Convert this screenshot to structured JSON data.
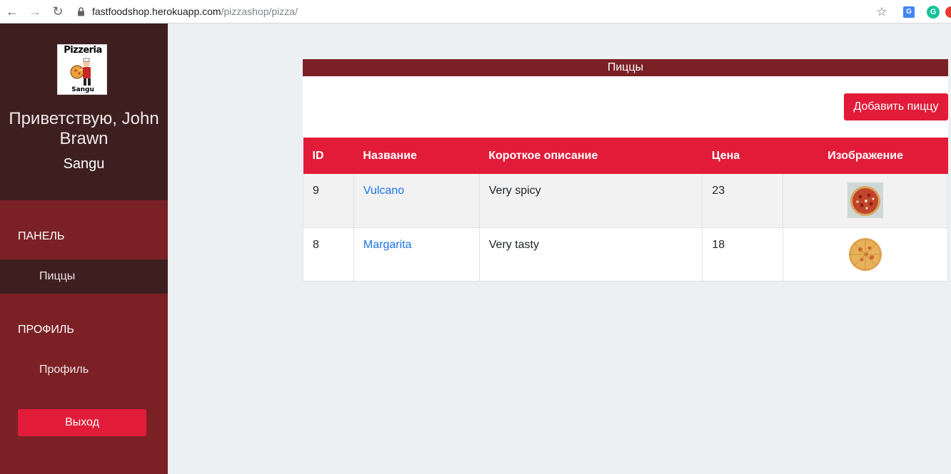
{
  "browser": {
    "url_host": "fastfoodshop.herokuapp.com",
    "url_path": "/pizzashop/pizza/"
  },
  "sidebar": {
    "logo_top": "Pizzeria",
    "logo_bottom": "Sangu",
    "welcome": "Приветствую, John Brawn",
    "shop": "Sangu",
    "section_panel": "ПАНЕЛЬ",
    "item_pizzas": "Пиццы",
    "section_profile": "ПРОФИЛЬ",
    "item_profile": "Профиль",
    "logout": "Выход"
  },
  "panel": {
    "title": "Пиццы",
    "add_button": "Добавить пиццу"
  },
  "table": {
    "headers": [
      "ID",
      "Название",
      "Короткое описание",
      "Цена",
      "Изображение"
    ],
    "rows": [
      {
        "id": "9",
        "name": "Vulcano",
        "description": "Very spicy",
        "price": "23",
        "image": "pizza-vulcano-image"
      },
      {
        "id": "8",
        "name": "Margarita",
        "description": "Very tasty",
        "price": "18",
        "image": "pizza-margarita-image"
      }
    ]
  },
  "colors": {
    "sidebar_dark": "#3e1f1f",
    "sidebar_main": "#7b2126",
    "accent_red": "#e11b38",
    "link": "#1a73e8"
  }
}
